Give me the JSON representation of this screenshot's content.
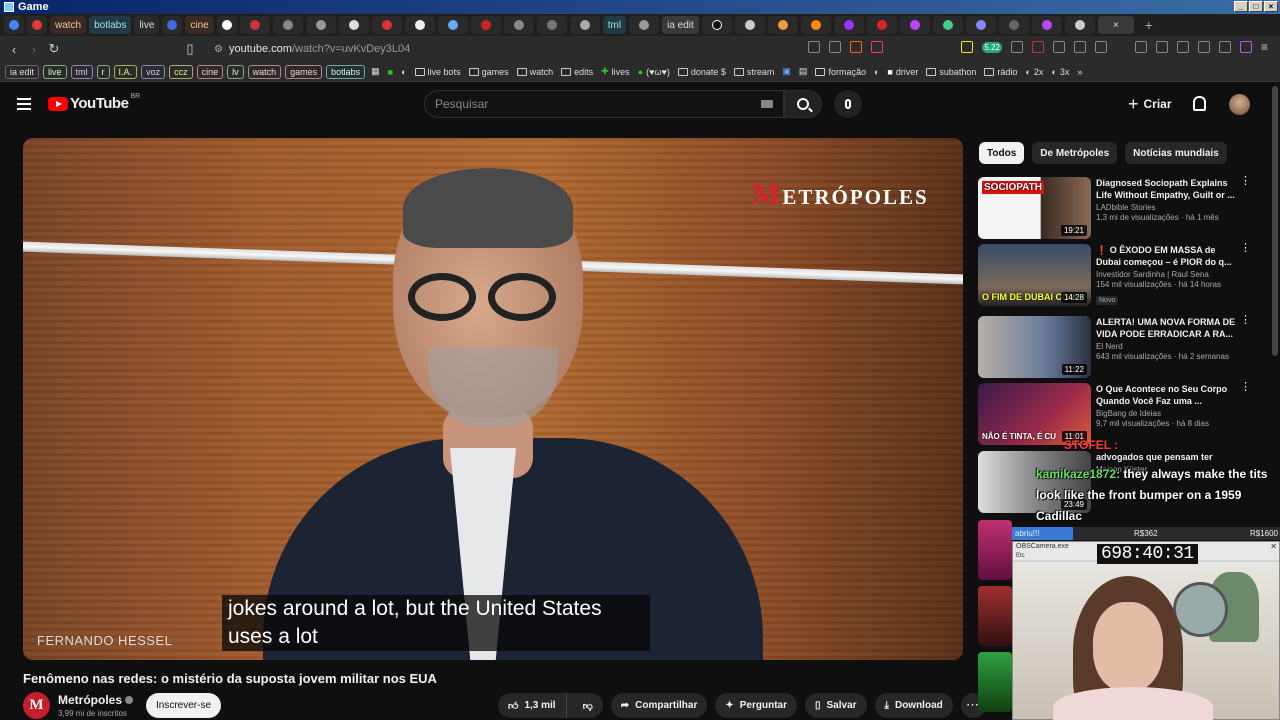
{
  "window": {
    "title": "Game"
  },
  "tabs": [
    {
      "label": "",
      "icon": "chrome-icon",
      "color": "#4285f4"
    },
    {
      "label": "",
      "icon": "red-circle-icon",
      "color": "#e53935"
    },
    {
      "label": "watch",
      "icon": "",
      "color": ""
    },
    {
      "label": "botlabs",
      "icon": "",
      "color": ""
    },
    {
      "label": "live",
      "icon": "",
      "color": ""
    },
    {
      "label": "",
      "icon": "r-icon",
      "color": "#4169e1"
    },
    {
      "label": "cine",
      "icon": "",
      "color": ""
    },
    {
      "label": "",
      "icon": "g-icon",
      "color": "#ffffff"
    },
    {
      "label": "tml",
      "icon": "",
      "color": ""
    },
    {
      "label": "ia edit",
      "icon": "",
      "color": ""
    }
  ],
  "address": {
    "host": "youtube.com",
    "path": "/watch?v=uvKvDey3L04",
    "badge": "5.22"
  },
  "bookmarks": {
    "chips": [
      "ia edit",
      "live",
      "tml",
      "r",
      "I.A.",
      "voz",
      "ccz",
      "cine",
      "lv",
      "watch",
      "games",
      "botlabs"
    ],
    "items": [
      "live bots",
      "games",
      "watch",
      "edits",
      "lives",
      "(♥ω♥)",
      "donate $",
      "stream",
      "formação",
      "driver",
      "subathon",
      "rádio",
      "2x",
      "3x"
    ]
  },
  "youtube": {
    "logo": "YouTube",
    "region": "BR",
    "search_placeholder": "Pesquisar",
    "create_label": "Criar"
  },
  "video": {
    "channel_watermark": "ETRÓPOLES",
    "watermark_initial": "M",
    "lower_third": "FERNANDO HESSEL",
    "caption_line1": "jokes around a lot, but the United States",
    "caption_line2": "uses a lot",
    "title": "Fenômeno nas redes: o mistério da suposta jovem militar nos EUA",
    "channel": "Metrópoles",
    "subscribers": "3,99 mi de inscritos",
    "subscribe_label": "Inscrever-se",
    "likes": "1,3 mil",
    "share_label": "Compartilhar",
    "ask_label": "Perguntar",
    "save_label": "Salvar",
    "download_label": "Download"
  },
  "filters": [
    "Todos",
    "De Metrópoles",
    "Notícias mundiais"
  ],
  "recommendations": [
    {
      "title": "Diagnosed Sociopath Explains Life Without Empathy, Guilt or ...",
      "channel": "LADbible Stories",
      "stats": "1,3 mi de visualizações · há 1 mês",
      "duration": "19:21",
      "thumb_text": "SOCIOPATH",
      "badge": ""
    },
    {
      "title": "❗ O ÊXODO EM MASSA de Dubai começou – é PIOR do q...",
      "channel": "Investidor Sardinha | Raul Sena",
      "stats": "154 mil visualizações · há 14 horas",
      "duration": "14:28",
      "thumb_text": "O FIM DE DUBAI COM",
      "badge": "Novo"
    },
    {
      "title": "ALERTA! UMA NOVA FORMA DE VIDA PODE ERRADICAR A RA...",
      "channel": "El Nerd",
      "stats": "643 mil visualizações · há 2 semanas",
      "duration": "11:22",
      "thumb_text": "",
      "badge": ""
    },
    {
      "title": "O Que Acontece no Seu Corpo Quando Você Faz uma ...",
      "channel": "BigBang de Ideias",
      "stats": "9,7 mil visualizações · há 8 dias",
      "duration": "11:01",
      "thumb_text": "NÃO É TINTA, É CU",
      "badge": ""
    },
    {
      "title": "advogados que pensam ter",
      "channel": "Maicon Küster",
      "stats": "",
      "duration": "23:49",
      "thumb_text": "",
      "badge": ""
    }
  ],
  "overlay": {
    "chat_top": "STOFEL :",
    "chat_user": "kamikaze1872:",
    "chat_msg": " they always make the tits look like the front bumper on a 1959 Cadillac",
    "goal_label": "abriu!!!",
    "goal_mid": "R$362",
    "goal_right": "R$1600",
    "goal_fraction": 0.226,
    "cam_title": "OBSCamera.exe",
    "cam_sub": "Etc",
    "timer": "698:40:31"
  },
  "colors": {
    "youtube_red": "#ff0000",
    "metropoles_red": "#d5202d",
    "chat_name": "#5fe35f"
  }
}
